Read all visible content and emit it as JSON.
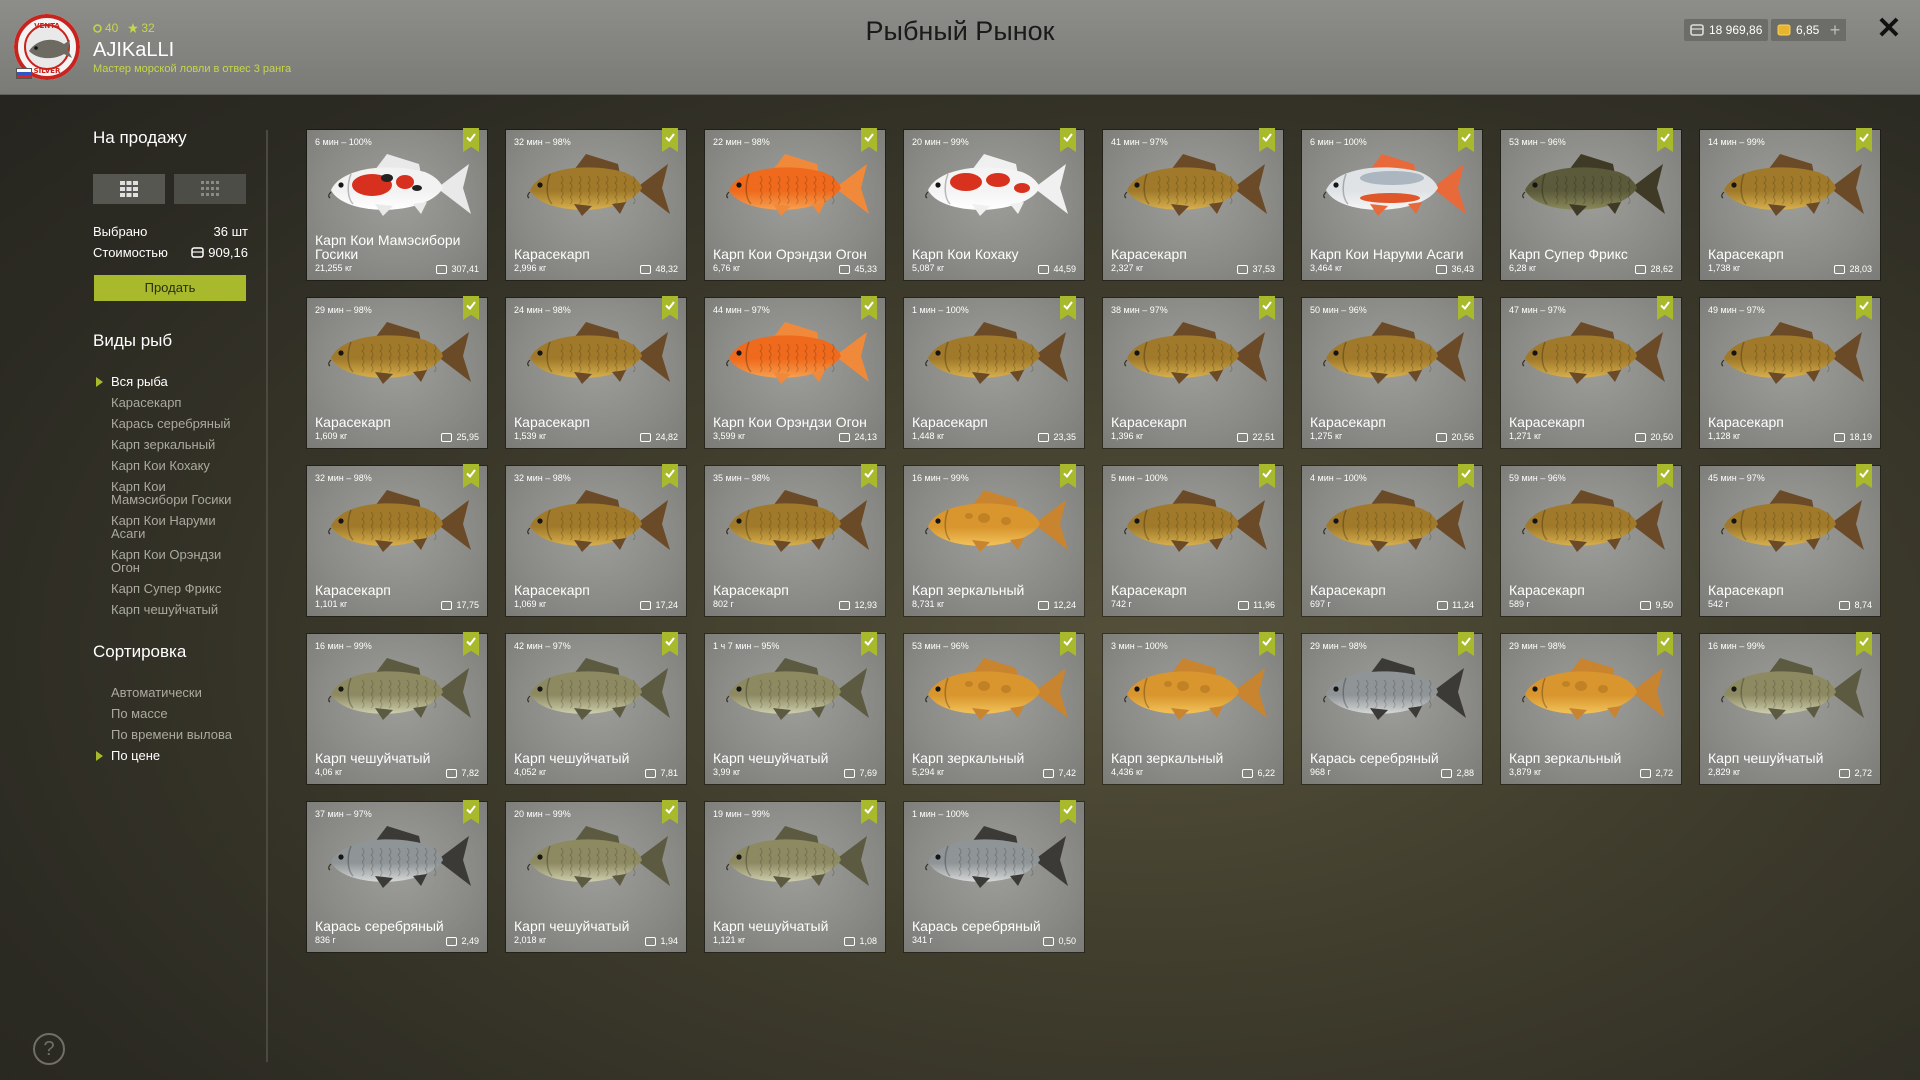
{
  "header": {
    "title": "Рыбный Рынок",
    "player_name": "AJIKaLLI",
    "player_rank": "Мастер морской ловли в отвес 3 ранга",
    "level_a": "40",
    "level_b": "32",
    "silver": "18 969,86",
    "gold": "6,85",
    "plus": "+",
    "close": "✕",
    "logo_text_top": "VENTA",
    "logo_text_bottom": "SILVER"
  },
  "sidebar": {
    "for_sale_title": "На продажу",
    "selected_label": "Выбрано",
    "selected_value": "36 шт",
    "cost_label": "Стоимостью",
    "cost_value": "909,16",
    "sell_button": "Продать",
    "species_title": "Виды рыб",
    "species": [
      "Вся рыба",
      "Карасекарп",
      "Карась серебряный",
      "Карп зеркальный",
      "Карп Кои Кохаку",
      "Карп Кои Мамэсибори Госики",
      "Карп Кои Наруми Асаги",
      "Карп Кои Орэндзи Огон",
      "Карп Супер Фрикс",
      "Карп чешуйчатый"
    ],
    "species_active_index": 0,
    "sort_title": "Сортировка",
    "sort": [
      "Автоматически",
      "По массе",
      "По времени вылова",
      "По цене"
    ],
    "sort_active_index": 3
  },
  "cards": [
    {
      "tag": "6 мин – 100%",
      "name": "Карп Кои Мамэсибори Госики",
      "weight": "21,255 кг",
      "price": "307,41",
      "style": "koi-red"
    },
    {
      "tag": "32 мин – 98%",
      "name": "Карасекарп",
      "weight": "2,996 кг",
      "price": "48,32",
      "style": "gold"
    },
    {
      "tag": "22 мин – 98%",
      "name": "Карп Кои Орэндзи Огон",
      "weight": "6,76 кг",
      "price": "45,33",
      "style": "orange"
    },
    {
      "tag": "20 мин – 99%",
      "name": "Карп Кои Кохаку",
      "weight": "5,087 кг",
      "price": "44,59",
      "style": "kohaku"
    },
    {
      "tag": "41 мин – 97%",
      "name": "Карасекарп",
      "weight": "2,327 кг",
      "price": "37,53",
      "style": "gold"
    },
    {
      "tag": "6 мин – 100%",
      "name": "Карп Кои Наруми Асаги",
      "weight": "3,464 кг",
      "price": "36,43",
      "style": "asagi"
    },
    {
      "tag": "53 мин – 96%",
      "name": "Карп Супер Фрикс",
      "weight": "6,28 кг",
      "price": "28,62",
      "style": "frix"
    },
    {
      "tag": "14 мин – 99%",
      "name": "Карасекарп",
      "weight": "1,738 кг",
      "price": "28,03",
      "style": "gold"
    },
    {
      "tag": "29 мин – 98%",
      "name": "Карасекарп",
      "weight": "1,609 кг",
      "price": "25,95",
      "style": "gold"
    },
    {
      "tag": "24 мин – 98%",
      "name": "Карасекарп",
      "weight": "1,539 кг",
      "price": "24,82",
      "style": "gold"
    },
    {
      "tag": "44 мин – 97%",
      "name": "Карп Кои Орэндзи Огон",
      "weight": "3,599 кг",
      "price": "24,13",
      "style": "orange"
    },
    {
      "tag": "1 мин – 100%",
      "name": "Карасекарп",
      "weight": "1,448 кг",
      "price": "23,35",
      "style": "gold"
    },
    {
      "tag": "38 мин – 97%",
      "name": "Карасекарп",
      "weight": "1,396 кг",
      "price": "22,51",
      "style": "gold"
    },
    {
      "tag": "50 мин – 96%",
      "name": "Карасекарп",
      "weight": "1,275 кг",
      "price": "20,56",
      "style": "gold"
    },
    {
      "tag": "47 мин – 97%",
      "name": "Карасекарп",
      "weight": "1,271 кг",
      "price": "20,50",
      "style": "gold"
    },
    {
      "tag": "49 мин – 97%",
      "name": "Карасекарп",
      "weight": "1,128 кг",
      "price": "18,19",
      "style": "gold"
    },
    {
      "tag": "32 мин – 98%",
      "name": "Карасекарп",
      "weight": "1,101 кг",
      "price": "17,75",
      "style": "gold"
    },
    {
      "tag": "32 мин – 98%",
      "name": "Карасекарп",
      "weight": "1,069 кг",
      "price": "17,24",
      "style": "gold"
    },
    {
      "tag": "35 мин – 98%",
      "name": "Карасекарп",
      "weight": "802 г",
      "price": "12,93",
      "style": "gold"
    },
    {
      "tag": "16 мин – 99%",
      "name": "Карп зеркальный",
      "weight": "8,731 кг",
      "price": "12,24",
      "style": "mirror"
    },
    {
      "tag": "5 мин – 100%",
      "name": "Карасекарп",
      "weight": "742 г",
      "price": "11,96",
      "style": "gold"
    },
    {
      "tag": "4 мин – 100%",
      "name": "Карасекарп",
      "weight": "697 г",
      "price": "11,24",
      "style": "gold"
    },
    {
      "tag": "59 мин – 96%",
      "name": "Карасекарп",
      "weight": "589 г",
      "price": "9,50",
      "style": "gold"
    },
    {
      "tag": "45 мин – 97%",
      "name": "Карасекарп",
      "weight": "542 г",
      "price": "8,74",
      "style": "gold"
    },
    {
      "tag": "16 мин – 99%",
      "name": "Карп чешуйчатый",
      "weight": "4,06 кг",
      "price": "7,82",
      "style": "common"
    },
    {
      "tag": "42 мин – 97%",
      "name": "Карп чешуйчатый",
      "weight": "4,052 кг",
      "price": "7,81",
      "style": "common"
    },
    {
      "tag": "1 ч 7 мин – 95%",
      "name": "Карп чешуйчатый",
      "weight": "3,99 кг",
      "price": "7,69",
      "style": "common"
    },
    {
      "tag": "53 мин – 96%",
      "name": "Карп зеркальный",
      "weight": "5,294 кг",
      "price": "7,42",
      "style": "mirror"
    },
    {
      "tag": "3 мин – 100%",
      "name": "Карп зеркальный",
      "weight": "4,436 кг",
      "price": "6,22",
      "style": "mirror"
    },
    {
      "tag": "29 мин – 98%",
      "name": "Карась серебряный",
      "weight": "968 г",
      "price": "2,88",
      "style": "silver"
    },
    {
      "tag": "29 мин – 98%",
      "name": "Карп зеркальный",
      "weight": "3,879 кг",
      "price": "2,72",
      "style": "mirror"
    },
    {
      "tag": "16 мин – 99%",
      "name": "Карп чешуйчатый",
      "weight": "2,829 кг",
      "price": "2,72",
      "style": "common"
    },
    {
      "tag": "37 мин – 97%",
      "name": "Карась серебряный",
      "weight": "836 г",
      "price": "2,49",
      "style": "silver"
    },
    {
      "tag": "20 мин – 99%",
      "name": "Карп чешуйчатый",
      "weight": "2,018 кг",
      "price": "1,94",
      "style": "common"
    },
    {
      "tag": "19 мин – 99%",
      "name": "Карп чешуйчатый",
      "weight": "1,121 кг",
      "price": "1,08",
      "style": "common"
    },
    {
      "tag": "1 мин – 100%",
      "name": "Карась серебряный",
      "weight": "341 г",
      "price": "0,50",
      "style": "silver"
    }
  ],
  "fish_styles": {
    "gold": {
      "body": "#a07a2a",
      "belly": "#d8b04e",
      "fin": "#6b4a28"
    },
    "orange": {
      "body": "#ef6a1c",
      "belly": "#f7a050",
      "fin": "#f08a3a"
    },
    "koi-red": {
      "body": "#f2f2f2",
      "belly": "#ffffff",
      "fin": "#e9e9e9",
      "spot": "#d7301f",
      "spot2": "#222222"
    },
    "kohaku": {
      "body": "#f4f4f4",
      "belly": "#ffffff",
      "fin": "#f0f0f0",
      "spot": "#d8321f"
    },
    "asagi": {
      "body": "#dfe3e6",
      "belly": "#f5f5f5",
      "fin": "#e86a3a",
      "spot": "#e0582a",
      "spot2": "#8a97a8"
    },
    "frix": {
      "body": "#5b5a3a",
      "belly": "#8a8a5a",
      "fin": "#3e3a26"
    },
    "mirror": {
      "body": "#d9952e",
      "belly": "#f2c35a",
      "fin": "#c98430"
    },
    "common": {
      "body": "#8d8a62",
      "belly": "#cfcfae",
      "fin": "#5c5a40"
    },
    "silver": {
      "body": "#8f9496",
      "belly": "#d6d9d9",
      "fin": "#3c3a36"
    }
  }
}
